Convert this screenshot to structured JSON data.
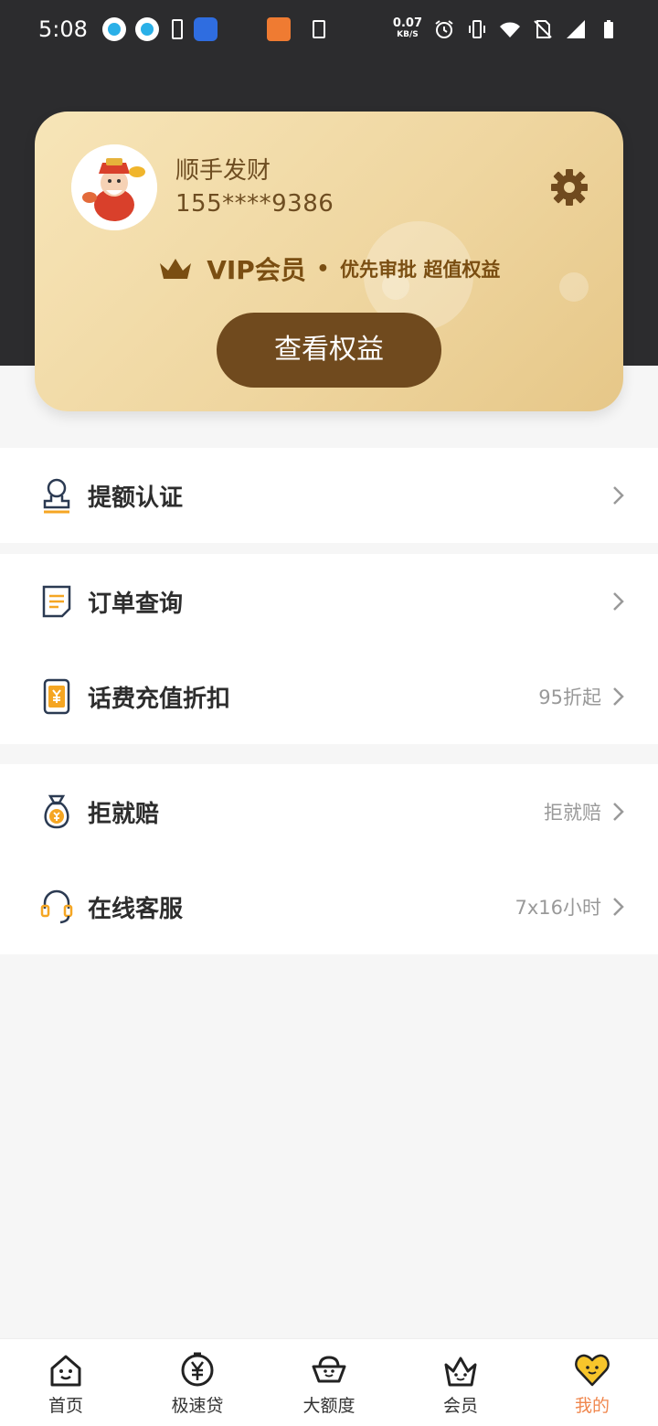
{
  "status_bar": {
    "time": "5:08",
    "net_speed": "0.07",
    "net_unit": "KB/S",
    "icons": [
      "tv-app-icon",
      "tv-app-icon",
      "battery-saver-icon",
      "wifi-app-icon",
      "orange-app-icon",
      "download-icon",
      "alarm-icon",
      "vibrate-icon",
      "wifi-icon",
      "no-sim-icon",
      "signal-icon",
      "battery-icon"
    ]
  },
  "profile": {
    "name": "顺手发财",
    "phone": "155****9386"
  },
  "vip": {
    "title": "VIP会员",
    "dot": "•",
    "subtitle": "优先审批 超值权益",
    "button": "查看权益"
  },
  "menu": {
    "group1": [
      {
        "label": "提额认证",
        "value": ""
      }
    ],
    "group2": [
      {
        "label": "订单查询",
        "value": ""
      },
      {
        "label": "话费充值折扣",
        "value": "95折起"
      }
    ],
    "group3": [
      {
        "label": "拒就赔",
        "value": "拒就赔"
      },
      {
        "label": "在线客服",
        "value": "7x16小时"
      }
    ]
  },
  "nav": {
    "items": [
      {
        "label": "首页",
        "active": false
      },
      {
        "label": "极速贷",
        "active": false
      },
      {
        "label": "大额度",
        "active": false
      },
      {
        "label": "会员",
        "active": false
      },
      {
        "label": "我的",
        "active": true
      }
    ]
  },
  "colors": {
    "header_bg": "#2c2c2e",
    "card_gold": "#efd6a0",
    "button_brown": "#704a1e",
    "accent_orange": "#f0874e"
  }
}
